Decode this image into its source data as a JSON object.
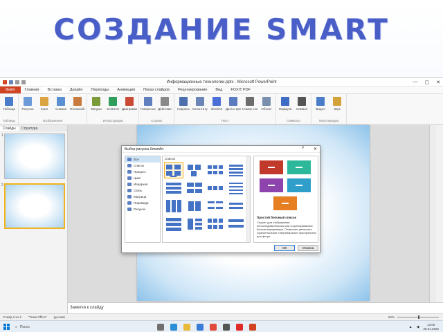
{
  "slide_title": "СОЗДАНИЕ SMART",
  "app": {
    "window_title": "Информационные технологии.pptx - Microsoft PowerPoint",
    "window_controls": [
      "—",
      "▢",
      "✕"
    ]
  },
  "ribbon_tabs": [
    "Файл",
    "Главная",
    "Вставка",
    "Дизайн",
    "Переходы",
    "Анимация",
    "Показ слайдов",
    "Рецензирование",
    "Вид",
    "FOXIT PDF"
  ],
  "ribbon_groups": [
    {
      "name": "Таблицы",
      "buttons": [
        {
          "label": "Таблица",
          "color": "#4a7cc9"
        }
      ]
    },
    {
      "name": "Изображения",
      "buttons": [
        {
          "label": "Рисунок",
          "color": "#6b9bd8"
        },
        {
          "label": "Клип",
          "color": "#d9a441"
        },
        {
          "label": "Снимок",
          "color": "#5a8fd1"
        },
        {
          "label": "Фотоальбом",
          "color": "#c87b3e"
        }
      ]
    },
    {
      "name": "Иллюстрации",
      "buttons": [
        {
          "label": "Фигуры",
          "color": "#7b9a3a"
        },
        {
          "label": "SmartArt",
          "color": "#2f9e5a"
        },
        {
          "label": "Диаграмма",
          "color": "#c94b36"
        }
      ]
    },
    {
      "name": "Ссылки",
      "buttons": [
        {
          "label": "Гиперссылка",
          "color": "#5f7fbf"
        },
        {
          "label": "Действие",
          "color": "#8a8a8a"
        }
      ]
    },
    {
      "name": "Текст",
      "buttons": [
        {
          "label": "Надпись",
          "color": "#4e6fae"
        },
        {
          "label": "Колонтитулы",
          "color": "#6a86b8"
        },
        {
          "label": "WordArt",
          "color": "#4b6fd6"
        },
        {
          "label": "Дата и время",
          "color": "#5b7bc1"
        },
        {
          "label": "Номер слайда",
          "color": "#6c6c6c"
        },
        {
          "label": "Объект",
          "color": "#7a8fae"
        }
      ]
    },
    {
      "name": "Символы",
      "buttons": [
        {
          "label": "Формула",
          "color": "#3f6cc4"
        },
        {
          "label": "Символ",
          "color": "#555555"
        }
      ]
    },
    {
      "name": "Мультимедиа",
      "buttons": [
        {
          "label": "Видео",
          "color": "#4a7cc9"
        },
        {
          "label": "Звук",
          "color": "#d4a23a"
        }
      ]
    }
  ],
  "panel_tabs": [
    "Слайды",
    "Структура"
  ],
  "thumbnails": [
    "1",
    "2"
  ],
  "notes_placeholder": "Заметки к слайду",
  "status": {
    "slide": "Слайд 2 из 2",
    "theme": "\"Тема Office\"",
    "language": "русский",
    "zoom": "62%"
  },
  "taskbar": {
    "search_placeholder": "Поиск",
    "apps": [
      {
        "name": "task-view",
        "color": "#6f6f6f"
      },
      {
        "name": "edge",
        "color": "#2b8fd6"
      },
      {
        "name": "explorer",
        "color": "#e8b93a"
      },
      {
        "name": "store",
        "color": "#3a7bd5"
      },
      {
        "name": "mail",
        "color": "#e24b3b"
      },
      {
        "name": "settings",
        "color": "#555555"
      },
      {
        "name": "yandex",
        "color": "#e02a2a"
      },
      {
        "name": "powerpoint",
        "color": "#d04423"
      }
    ],
    "time": "13:00",
    "date": "25.01.2022"
  },
  "dialog": {
    "title": "Выбор рисунка SmartArt",
    "controls": [
      "?",
      "✕"
    ],
    "categories": [
      "Все",
      "Список",
      "Процесс",
      "Цикл",
      "Иерархия",
      "Связь",
      "Матрица",
      "Пирамида",
      "Рисунок"
    ],
    "layouts_header": "Список",
    "preview_title": "Простой блочный список",
    "preview_desc": "Служит для отображения непоследовательных или сгруппированных блоков информации. Позволяет увеличить горизонтальное и вертикальное пространство для фигур.",
    "ok_label": "ОК",
    "cancel_label": "Отмена",
    "preview_colors": [
      "#c0392b",
      "#2eb89b",
      "#8e44ad",
      "#2f9ec9",
      "#e67e22"
    ]
  }
}
